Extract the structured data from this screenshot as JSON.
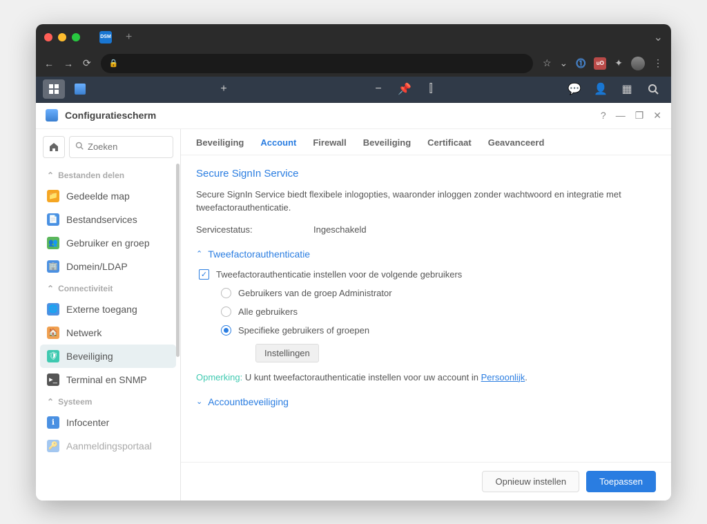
{
  "browser": {
    "tab_label": "DSM"
  },
  "dsm_toolbar": {},
  "window": {
    "title": "Configuratiescherm"
  },
  "sidebar": {
    "search_placeholder": "Zoeken",
    "section_share": "Bestanden delen",
    "items_share": [
      {
        "label": "Gedeelde map"
      },
      {
        "label": "Bestandservices"
      },
      {
        "label": "Gebruiker en groep"
      },
      {
        "label": "Domein/LDAP"
      }
    ],
    "section_conn": "Connectiviteit",
    "items_conn": [
      {
        "label": "Externe toegang"
      },
      {
        "label": "Netwerk"
      },
      {
        "label": "Beveiliging"
      },
      {
        "label": "Terminal en SNMP"
      }
    ],
    "section_sys": "Systeem",
    "items_sys": [
      {
        "label": "Infocenter"
      },
      {
        "label": "Aanmeldingsportaal"
      }
    ]
  },
  "tabs": [
    {
      "label": "Beveiliging",
      "active": false
    },
    {
      "label": "Account",
      "active": true
    },
    {
      "label": "Firewall",
      "active": false
    },
    {
      "label": "Beveiliging",
      "active": false
    },
    {
      "label": "Certificaat",
      "active": false
    },
    {
      "label": "Geavanceerd",
      "active": false
    }
  ],
  "panel": {
    "h1": "Secure SignIn Service",
    "desc": "Secure SignIn Service biedt flexibele inlogopties, waaronder inloggen zonder wachtwoord en integratie met tweefactorauthenticatie.",
    "status_k": "Servicestatus:",
    "status_v": "Ingeschakeld",
    "sec_2fa": "Tweefactorauthenticatie",
    "chk_2fa": "Tweefactorauthenticatie instellen voor de volgende gebruikers",
    "radios": [
      {
        "label": "Gebruikers van de groep Administrator",
        "selected": false
      },
      {
        "label": "Alle gebruikers",
        "selected": false
      },
      {
        "label": "Specifieke gebruikers of groepen",
        "selected": true
      }
    ],
    "btn_settings": "Instellingen",
    "note_label": "Opmerking:",
    "note_text": " U kunt tweefactorauthenticatie instellen voor uw account in ",
    "note_link": "Persoonlijk",
    "sec_acct": "Accountbeveiliging"
  },
  "footer": {
    "reset": "Opnieuw instellen",
    "apply": "Toepassen"
  }
}
